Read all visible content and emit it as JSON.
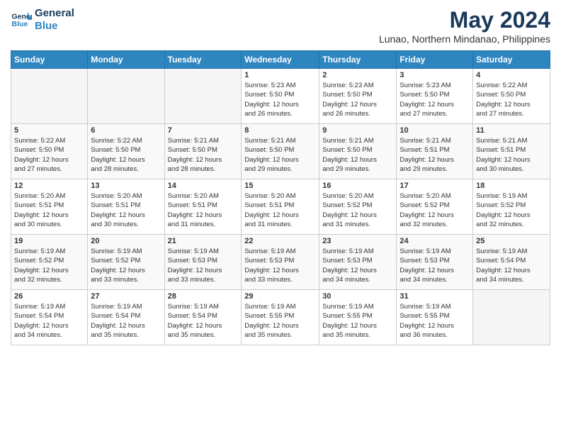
{
  "logo": {
    "line1": "General",
    "line2": "Blue"
  },
  "title": "May 2024",
  "location": "Lunao, Northern Mindanao, Philippines",
  "weekdays": [
    "Sunday",
    "Monday",
    "Tuesday",
    "Wednesday",
    "Thursday",
    "Friday",
    "Saturday"
  ],
  "weeks": [
    [
      {
        "day": "",
        "info": ""
      },
      {
        "day": "",
        "info": ""
      },
      {
        "day": "",
        "info": ""
      },
      {
        "day": "1",
        "info": "Sunrise: 5:23 AM\nSunset: 5:50 PM\nDaylight: 12 hours\nand 26 minutes."
      },
      {
        "day": "2",
        "info": "Sunrise: 5:23 AM\nSunset: 5:50 PM\nDaylight: 12 hours\nand 26 minutes."
      },
      {
        "day": "3",
        "info": "Sunrise: 5:23 AM\nSunset: 5:50 PM\nDaylight: 12 hours\nand 27 minutes."
      },
      {
        "day": "4",
        "info": "Sunrise: 5:22 AM\nSunset: 5:50 PM\nDaylight: 12 hours\nand 27 minutes."
      }
    ],
    [
      {
        "day": "5",
        "info": "Sunrise: 5:22 AM\nSunset: 5:50 PM\nDaylight: 12 hours\nand 27 minutes."
      },
      {
        "day": "6",
        "info": "Sunrise: 5:22 AM\nSunset: 5:50 PM\nDaylight: 12 hours\nand 28 minutes."
      },
      {
        "day": "7",
        "info": "Sunrise: 5:21 AM\nSunset: 5:50 PM\nDaylight: 12 hours\nand 28 minutes."
      },
      {
        "day": "8",
        "info": "Sunrise: 5:21 AM\nSunset: 5:50 PM\nDaylight: 12 hours\nand 29 minutes."
      },
      {
        "day": "9",
        "info": "Sunrise: 5:21 AM\nSunset: 5:50 PM\nDaylight: 12 hours\nand 29 minutes."
      },
      {
        "day": "10",
        "info": "Sunrise: 5:21 AM\nSunset: 5:51 PM\nDaylight: 12 hours\nand 29 minutes."
      },
      {
        "day": "11",
        "info": "Sunrise: 5:21 AM\nSunset: 5:51 PM\nDaylight: 12 hours\nand 30 minutes."
      }
    ],
    [
      {
        "day": "12",
        "info": "Sunrise: 5:20 AM\nSunset: 5:51 PM\nDaylight: 12 hours\nand 30 minutes."
      },
      {
        "day": "13",
        "info": "Sunrise: 5:20 AM\nSunset: 5:51 PM\nDaylight: 12 hours\nand 30 minutes."
      },
      {
        "day": "14",
        "info": "Sunrise: 5:20 AM\nSunset: 5:51 PM\nDaylight: 12 hours\nand 31 minutes."
      },
      {
        "day": "15",
        "info": "Sunrise: 5:20 AM\nSunset: 5:51 PM\nDaylight: 12 hours\nand 31 minutes."
      },
      {
        "day": "16",
        "info": "Sunrise: 5:20 AM\nSunset: 5:52 PM\nDaylight: 12 hours\nand 31 minutes."
      },
      {
        "day": "17",
        "info": "Sunrise: 5:20 AM\nSunset: 5:52 PM\nDaylight: 12 hours\nand 32 minutes."
      },
      {
        "day": "18",
        "info": "Sunrise: 5:19 AM\nSunset: 5:52 PM\nDaylight: 12 hours\nand 32 minutes."
      }
    ],
    [
      {
        "day": "19",
        "info": "Sunrise: 5:19 AM\nSunset: 5:52 PM\nDaylight: 12 hours\nand 32 minutes."
      },
      {
        "day": "20",
        "info": "Sunrise: 5:19 AM\nSunset: 5:52 PM\nDaylight: 12 hours\nand 33 minutes."
      },
      {
        "day": "21",
        "info": "Sunrise: 5:19 AM\nSunset: 5:53 PM\nDaylight: 12 hours\nand 33 minutes."
      },
      {
        "day": "22",
        "info": "Sunrise: 5:19 AM\nSunset: 5:53 PM\nDaylight: 12 hours\nand 33 minutes."
      },
      {
        "day": "23",
        "info": "Sunrise: 5:19 AM\nSunset: 5:53 PM\nDaylight: 12 hours\nand 34 minutes."
      },
      {
        "day": "24",
        "info": "Sunrise: 5:19 AM\nSunset: 5:53 PM\nDaylight: 12 hours\nand 34 minutes."
      },
      {
        "day": "25",
        "info": "Sunrise: 5:19 AM\nSunset: 5:54 PM\nDaylight: 12 hours\nand 34 minutes."
      }
    ],
    [
      {
        "day": "26",
        "info": "Sunrise: 5:19 AM\nSunset: 5:54 PM\nDaylight: 12 hours\nand 34 minutes."
      },
      {
        "day": "27",
        "info": "Sunrise: 5:19 AM\nSunset: 5:54 PM\nDaylight: 12 hours\nand 35 minutes."
      },
      {
        "day": "28",
        "info": "Sunrise: 5:19 AM\nSunset: 5:54 PM\nDaylight: 12 hours\nand 35 minutes."
      },
      {
        "day": "29",
        "info": "Sunrise: 5:19 AM\nSunset: 5:55 PM\nDaylight: 12 hours\nand 35 minutes."
      },
      {
        "day": "30",
        "info": "Sunrise: 5:19 AM\nSunset: 5:55 PM\nDaylight: 12 hours\nand 35 minutes."
      },
      {
        "day": "31",
        "info": "Sunrise: 5:19 AM\nSunset: 5:55 PM\nDaylight: 12 hours\nand 36 minutes."
      },
      {
        "day": "",
        "info": ""
      }
    ]
  ]
}
